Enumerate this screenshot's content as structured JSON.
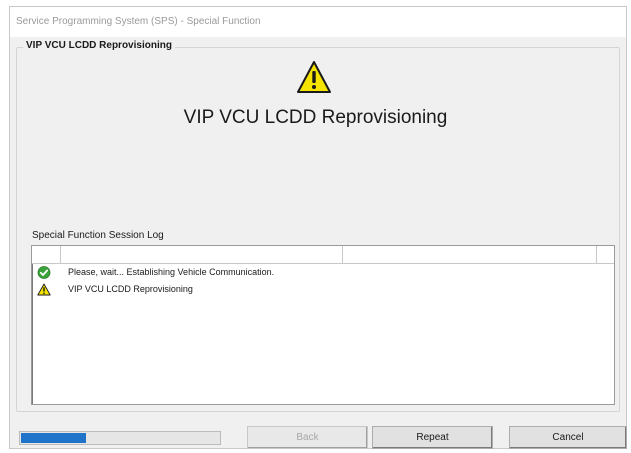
{
  "window": {
    "title": "Service Programming System (SPS) - Special Function"
  },
  "group": {
    "legend": "VIP VCU LCDD Reprovisioning"
  },
  "main": {
    "icon": "warning-icon",
    "heading": "VIP VCU LCDD Reprovisioning"
  },
  "log": {
    "label": "Special Function Session Log",
    "entries": [
      {
        "icon": "check-circle-icon",
        "message": "Please, wait... Establishing Vehicle Communication."
      },
      {
        "icon": "warning-icon",
        "message": "VIP VCU LCDD Reprovisioning"
      }
    ]
  },
  "progress": {
    "fraction": 0.33
  },
  "buttons": {
    "back": "Back",
    "repeat": "Repeat",
    "cancel": "Cancel"
  },
  "colors": {
    "progress_fill": "#1f73c9",
    "warning_yellow": "#f5e400",
    "check_green": "#3aa23a"
  }
}
